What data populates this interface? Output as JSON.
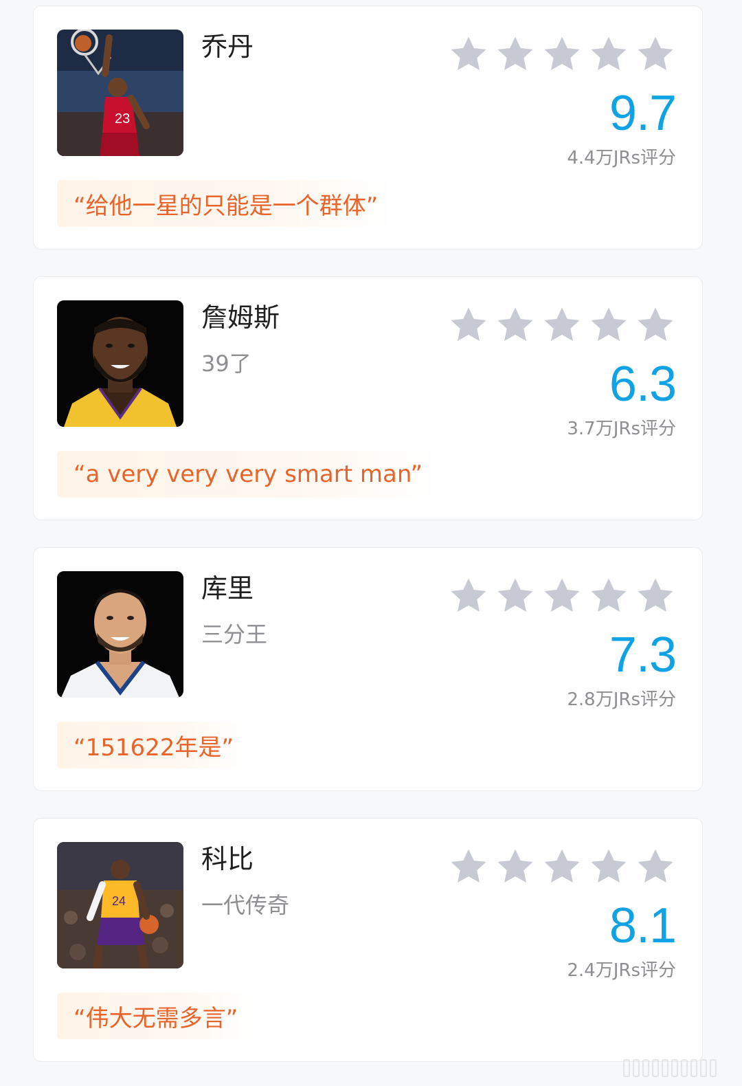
{
  "colors": {
    "score": "#0fa2e4",
    "quote_text": "#e8642b",
    "quote_bg": "#fff4e8",
    "star_empty": "#c7c9d3"
  },
  "players": [
    {
      "name": "乔丹",
      "tagline": "",
      "score": "9.7",
      "rating_count": "4.4万JRs评分",
      "quote": "“给他一星的只能是一个群体”",
      "stars_filled": 0,
      "avatar": "jordan-photo"
    },
    {
      "name": "詹姆斯",
      "tagline": "39了",
      "score": "6.3",
      "rating_count": "3.7万JRs评分",
      "quote": "“a very very very smart man”",
      "stars_filled": 0,
      "avatar": "lebron-photo"
    },
    {
      "name": "库里",
      "tagline": "三分王",
      "score": "7.3",
      "rating_count": "2.8万JRs评分",
      "quote": "“151622年是”",
      "stars_filled": 0,
      "avatar": "curry-photo"
    },
    {
      "name": "科比",
      "tagline": "一代传奇",
      "score": "8.1",
      "rating_count": "2.4万JRs评分",
      "quote": "“伟大无需多言”",
      "stars_filled": 0,
      "avatar": "kobe-photo"
    }
  ]
}
